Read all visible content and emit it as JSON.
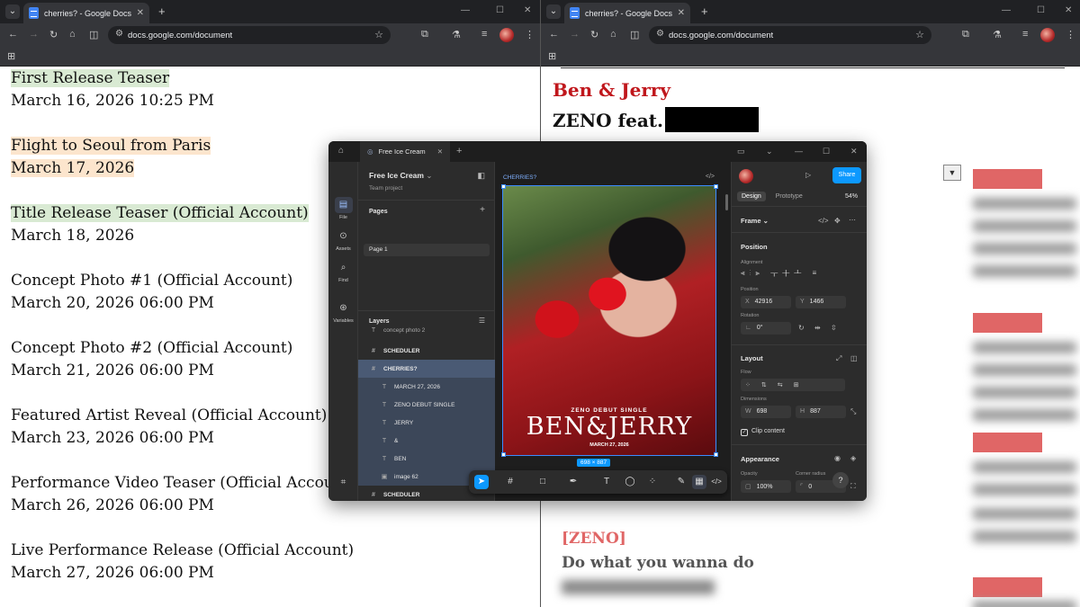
{
  "left_browser": {
    "tab_title": "cherries? - Google Docs",
    "url": "docs.google.com/document",
    "entries": [
      {
        "title": "First Release Teaser",
        "date": "March 16, 2026 10:25 PM",
        "highlight": "green",
        "title_only": true
      },
      {
        "title": "Flight to Seoul from Paris",
        "date": "March 17, 2026",
        "highlight": "orange"
      },
      {
        "title": "Title Release Teaser (Official Account)",
        "date": "March 18, 2026",
        "highlight": "green",
        "title_only": true
      },
      {
        "title": "Concept Photo #1  (Official Account)",
        "date": "March 20, 2026 06:00 PM"
      },
      {
        "title": "Concept Photo #2 (Official Account)",
        "date": "March 21, 2026 06:00 PM"
      },
      {
        "title": "Featured Artist Reveal  (Official Account)",
        "date": "March 23, 2026 06:00 PM"
      },
      {
        "title": "Performance Video Teaser (Official Account",
        "date": "March 26, 2026 06:00 PM"
      },
      {
        "title": "Live Performance Release (Official Account)",
        "date": "March 27, 2026 06:00 PM"
      }
    ]
  },
  "right_browser": {
    "tab_title": "cherries? - Google Docs",
    "url": "docs.google.com/document",
    "song_title": "Ben & Jerry",
    "song_artist": "ZENO feat.",
    "lyric_tag": "[ZENO]",
    "lyric_line": "Do what you wanna do"
  },
  "figma": {
    "tab_title": "Free Ice Cream",
    "file_name": "Free Ice Cream",
    "project": "Team project",
    "pages_label": "Pages",
    "page_1": "Page 1",
    "layers_label": "Layers",
    "rail": {
      "file": "File",
      "assets": "Assets",
      "find": "Find",
      "variables": "Variables"
    },
    "layers": [
      {
        "name": "concept photo 2",
        "kind": "plain"
      },
      {
        "name": "SCHEDULER",
        "kind": "parent"
      },
      {
        "name": "CHERRIES?",
        "kind": "sel"
      },
      {
        "name": "MARCH 27, 2026",
        "kind": "child"
      },
      {
        "name": "ZENO DEBUT SINGLE",
        "kind": "child"
      },
      {
        "name": "JERRY",
        "kind": "child"
      },
      {
        "name": "&",
        "kind": "child"
      },
      {
        "name": "BEN",
        "kind": "child"
      },
      {
        "name": "image 62",
        "kind": "child"
      },
      {
        "name": "SCHEDULER",
        "kind": "parent"
      }
    ],
    "frame_label": "CHERRIES?",
    "poster": {
      "subtitle": "ZENO DEBUT SINGLE",
      "title": "BEN&JERRY",
      "date": "MARCH 27, 2026"
    },
    "dimensions_badge": "698 × 887",
    "share": "Share",
    "tab_design": "Design",
    "tab_prototype": "Prototype",
    "zoom": "54%",
    "frame_dropdown": "Frame",
    "position_h": "Position",
    "alignment_s": "Alignment",
    "position_s": "Position",
    "x_label": "X",
    "x_value": "42916",
    "y_label": "Y",
    "y_value": "1466",
    "rotation_s": "Rotation",
    "rotation_value": "0°",
    "layout_h": "Layout",
    "flow_s": "Flow",
    "dimensions_s": "Dimensions",
    "w_label": "W",
    "w_value": "698",
    "h_label": "H",
    "h_value": "887",
    "clip_content": "Clip content",
    "appearance_h": "Appearance",
    "opacity_s": "Opacity",
    "opacity_value": "100%",
    "radius_s": "Corner radius",
    "radius_value": "0",
    "help": "?"
  }
}
